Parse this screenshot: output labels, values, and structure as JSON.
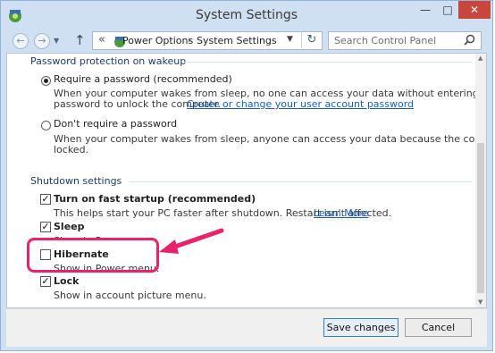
{
  "window": {
    "title": "System Settings"
  },
  "nav": {
    "breadcrumb": [
      "Power Options",
      "System Settings"
    ],
    "breadcrumb_prefix": "«",
    "search_placeholder": "Search Control Panel"
  },
  "password_section": {
    "heading": "Password protection on wakeup",
    "options": [
      {
        "label": "Require a password (recommended)",
        "selected": true,
        "desc1": "When your computer wakes from sleep, no one can access your data without entering the correct",
        "desc2": "password to unlock the computer.",
        "link": "Create or change your user account password"
      },
      {
        "label": "Don't require a password",
        "selected": false,
        "desc1": "When your computer wakes from sleep, anyone can access your data because the computer isn't",
        "desc2": "locked."
      }
    ]
  },
  "shutdown_section": {
    "heading": "Shutdown settings",
    "items": [
      {
        "label": "Turn on fast startup (recommended)",
        "checked": true,
        "desc": "This helps start your PC faster after shutdown. Restart isn't affected.",
        "link": "Learn More"
      },
      {
        "label": "Sleep",
        "checked": true,
        "desc": "Show in Power menu."
      },
      {
        "label": "Hibernate",
        "checked": false,
        "desc": "Show in Power menu."
      },
      {
        "label": "Lock",
        "checked": true,
        "desc": "Show in account picture menu."
      }
    ]
  },
  "buttons": {
    "save": "Save changes",
    "cancel": "Cancel"
  },
  "annotation": {
    "color": "#e8226b"
  }
}
